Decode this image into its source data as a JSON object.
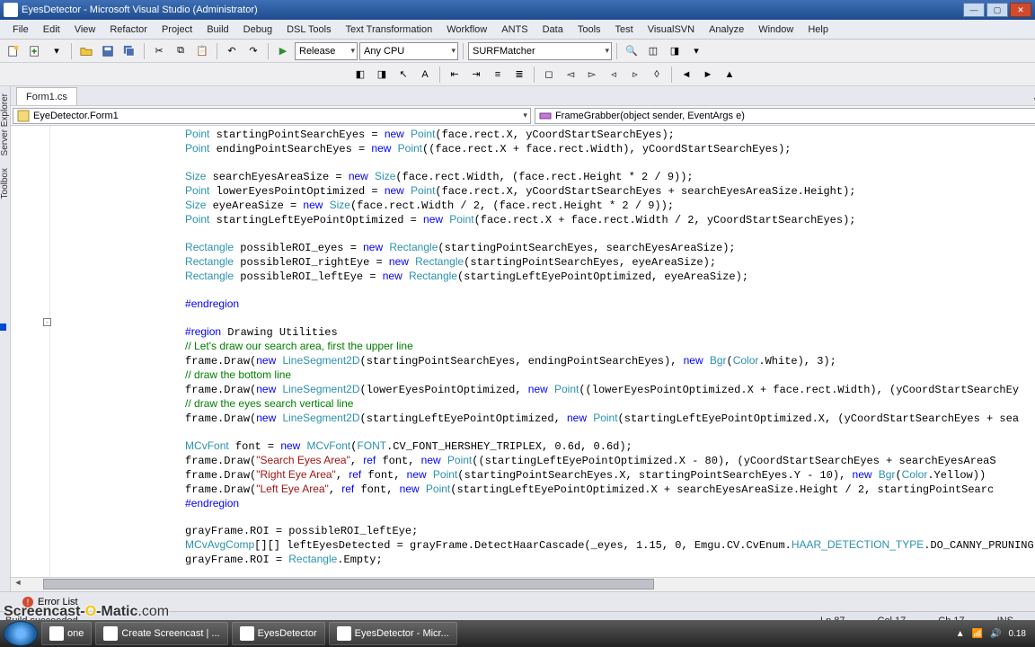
{
  "window": {
    "title": "EyesDetector - Microsoft Visual Studio (Administrator)"
  },
  "menu": {
    "items": [
      "File",
      "Edit",
      "View",
      "Refactor",
      "Project",
      "Build",
      "Debug",
      "DSL Tools",
      "Text Transformation",
      "Workflow",
      "ANTS",
      "Data",
      "Tools",
      "Test",
      "VisualSVN",
      "Analyze",
      "Window",
      "Help"
    ]
  },
  "toolbar": {
    "config": "Release",
    "platform": "Any CPU",
    "startup": "SURFMatcher"
  },
  "doc": {
    "tab": "Form1.cs"
  },
  "nav": {
    "type": "EyeDetector.Form1",
    "member": "FrameGrabber(object sender, EventArgs e)"
  },
  "bottom": {
    "errorlist": "Error List"
  },
  "status": {
    "build": "Build succeeded",
    "ln": "Ln 87",
    "col": "Col 17",
    "ch": "Ch 17",
    "ins": "INS"
  },
  "leftpanels": [
    "Server Explorer",
    "Toolbox"
  ],
  "taskbar": {
    "items": [
      "one",
      "Create Screencast | ...",
      "EyesDetector",
      "EyesDetector - Micr..."
    ],
    "time": "0.18"
  },
  "watermark": {
    "a": "Screencast-",
    "b": "O",
    "c": "-Matic",
    "d": ".com"
  },
  "code": {
    "lines": [
      {
        "indent": 20,
        "t": [
          [
            "typ",
            "Point"
          ],
          [
            "",
            " startingPointSearchEyes = "
          ],
          [
            "kw",
            "new"
          ],
          [
            "",
            " "
          ],
          [
            "typ",
            "Point"
          ],
          [
            "",
            "(face.rect.X, yCoordStartSearchEyes);"
          ]
        ]
      },
      {
        "indent": 20,
        "t": [
          [
            "typ",
            "Point"
          ],
          [
            "",
            " endingPointSearchEyes = "
          ],
          [
            "kw",
            "new"
          ],
          [
            "",
            " "
          ],
          [
            "typ",
            "Point"
          ],
          [
            "",
            "((face.rect.X + face.rect.Width), yCoordStartSearchEyes);"
          ]
        ]
      },
      {
        "blank": true
      },
      {
        "indent": 20,
        "t": [
          [
            "typ",
            "Size"
          ],
          [
            "",
            " searchEyesAreaSize = "
          ],
          [
            "kw",
            "new"
          ],
          [
            "",
            " "
          ],
          [
            "typ",
            "Size"
          ],
          [
            "",
            "(face.rect.Width, (face.rect.Height * 2 / 9));"
          ]
        ]
      },
      {
        "indent": 20,
        "t": [
          [
            "typ",
            "Point"
          ],
          [
            "",
            " lowerEyesPointOptimized = "
          ],
          [
            "kw",
            "new"
          ],
          [
            "",
            " "
          ],
          [
            "typ",
            "Point"
          ],
          [
            "",
            "(face.rect.X, yCoordStartSearchEyes + searchEyesAreaSize.Height);"
          ]
        ]
      },
      {
        "indent": 20,
        "t": [
          [
            "typ",
            "Size"
          ],
          [
            "",
            " eyeAreaSize = "
          ],
          [
            "kw",
            "new"
          ],
          [
            "",
            " "
          ],
          [
            "typ",
            "Size"
          ],
          [
            "",
            "(face.rect.Width / 2, (face.rect.Height * 2 / 9));"
          ]
        ]
      },
      {
        "indent": 20,
        "t": [
          [
            "typ",
            "Point"
          ],
          [
            "",
            " startingLeftEyePointOptimized = "
          ],
          [
            "kw",
            "new"
          ],
          [
            "",
            " "
          ],
          [
            "typ",
            "Point"
          ],
          [
            "",
            "(face.rect.X + face.rect.Width / 2, yCoordStartSearchEyes);"
          ]
        ]
      },
      {
        "blank": true
      },
      {
        "indent": 20,
        "t": [
          [
            "typ",
            "Rectangle"
          ],
          [
            "",
            " possibleROI_eyes = "
          ],
          [
            "kw",
            "new"
          ],
          [
            "",
            " "
          ],
          [
            "typ",
            "Rectangle"
          ],
          [
            "",
            "(startingPointSearchEyes, searchEyesAreaSize);"
          ]
        ]
      },
      {
        "indent": 20,
        "t": [
          [
            "typ",
            "Rectangle"
          ],
          [
            "",
            " possibleROI_rightEye = "
          ],
          [
            "kw",
            "new"
          ],
          [
            "",
            " "
          ],
          [
            "typ",
            "Rectangle"
          ],
          [
            "",
            "(startingPointSearchEyes, eyeAreaSize);"
          ]
        ]
      },
      {
        "indent": 20,
        "t": [
          [
            "typ",
            "Rectangle"
          ],
          [
            "",
            " possibleROI_leftEye = "
          ],
          [
            "kw",
            "new"
          ],
          [
            "",
            " "
          ],
          [
            "typ",
            "Rectangle"
          ],
          [
            "",
            "(startingLeftEyePointOptimized, eyeAreaSize);"
          ]
        ]
      },
      {
        "blank": true
      },
      {
        "indent": 20,
        "t": [
          [
            "pp",
            "#endregion"
          ]
        ]
      },
      {
        "blank": true
      },
      {
        "indent": 20,
        "t": [
          [
            "pp",
            "#region"
          ],
          [
            "",
            " Drawing Utilities"
          ]
        ]
      },
      {
        "indent": 20,
        "t": [
          [
            "cmt",
            "// Let's draw our search area, first the upper line"
          ]
        ]
      },
      {
        "indent": 20,
        "t": [
          [
            "",
            "frame.Draw("
          ],
          [
            "kw",
            "new"
          ],
          [
            "",
            " "
          ],
          [
            "typ",
            "LineSegment2D"
          ],
          [
            "",
            "(startingPointSearchEyes, endingPointSearchEyes), "
          ],
          [
            "kw",
            "new"
          ],
          [
            "",
            " "
          ],
          [
            "typ",
            "Bgr"
          ],
          [
            "",
            "("
          ],
          [
            "typ",
            "Color"
          ],
          [
            "",
            ".White), 3);"
          ]
        ]
      },
      {
        "indent": 20,
        "t": [
          [
            "cmt",
            "// draw the bottom line"
          ]
        ]
      },
      {
        "indent": 20,
        "t": [
          [
            "",
            "frame.Draw("
          ],
          [
            "kw",
            "new"
          ],
          [
            "",
            " "
          ],
          [
            "typ",
            "LineSegment2D"
          ],
          [
            "",
            "(lowerEyesPointOptimized, "
          ],
          [
            "kw",
            "new"
          ],
          [
            "",
            " "
          ],
          [
            "typ",
            "Point"
          ],
          [
            "",
            "((lowerEyesPointOptimized.X + face.rect.Width), (yCoordStartSearchEy"
          ]
        ]
      },
      {
        "indent": 20,
        "t": [
          [
            "cmt",
            "// draw the eyes search vertical line"
          ]
        ]
      },
      {
        "indent": 20,
        "t": [
          [
            "",
            "frame.Draw("
          ],
          [
            "kw",
            "new"
          ],
          [
            "",
            " "
          ],
          [
            "typ",
            "LineSegment2D"
          ],
          [
            "",
            "(startingLeftEyePointOptimized, "
          ],
          [
            "kw",
            "new"
          ],
          [
            "",
            " "
          ],
          [
            "typ",
            "Point"
          ],
          [
            "",
            "(startingLeftEyePointOptimized.X, (yCoordStartSearchEyes + sea"
          ]
        ]
      },
      {
        "blank": true
      },
      {
        "indent": 20,
        "t": [
          [
            "typ",
            "MCvFont"
          ],
          [
            "",
            " font = "
          ],
          [
            "kw",
            "new"
          ],
          [
            "",
            " "
          ],
          [
            "typ",
            "MCvFont"
          ],
          [
            "",
            "("
          ],
          [
            "typ",
            "FONT"
          ],
          [
            "",
            ".CV_FONT_HERSHEY_TRIPLEX, 0.6d, 0.6d);"
          ]
        ]
      },
      {
        "indent": 20,
        "t": [
          [
            "",
            "frame.Draw("
          ],
          [
            "str",
            "\"Search Eyes Area\""
          ],
          [
            "",
            ", "
          ],
          [
            "kw",
            "ref"
          ],
          [
            "",
            " font, "
          ],
          [
            "kw",
            "new"
          ],
          [
            "",
            " "
          ],
          [
            "typ",
            "Point"
          ],
          [
            "",
            "((startingLeftEyePointOptimized.X - 80), (yCoordStartSearchEyes + searchEyesAreaS"
          ]
        ]
      },
      {
        "indent": 20,
        "t": [
          [
            "",
            "frame.Draw("
          ],
          [
            "str",
            "\"Right Eye Area\""
          ],
          [
            "",
            ", "
          ],
          [
            "kw",
            "ref"
          ],
          [
            "",
            " font, "
          ],
          [
            "kw",
            "new"
          ],
          [
            "",
            " "
          ],
          [
            "typ",
            "Point"
          ],
          [
            "",
            "(startingPointSearchEyes.X, startingPointSearchEyes.Y - 10), "
          ],
          [
            "kw",
            "new"
          ],
          [
            "",
            " "
          ],
          [
            "typ",
            "Bgr"
          ],
          [
            "",
            "("
          ],
          [
            "typ",
            "Color"
          ],
          [
            "",
            ".Yellow))"
          ]
        ]
      },
      {
        "indent": 20,
        "t": [
          [
            "",
            "frame.Draw("
          ],
          [
            "str",
            "\"Left Eye Area\""
          ],
          [
            "",
            ", "
          ],
          [
            "kw",
            "ref"
          ],
          [
            "",
            " font, "
          ],
          [
            "kw",
            "new"
          ],
          [
            "",
            " "
          ],
          [
            "typ",
            "Point"
          ],
          [
            "",
            "(startingLeftEyePointOptimized.X + searchEyesAreaSize.Height / 2, startingPointSearc"
          ]
        ]
      },
      {
        "indent": 20,
        "t": [
          [
            "pp",
            "#endregion"
          ]
        ]
      },
      {
        "blank": true
      },
      {
        "indent": 20,
        "t": [
          [
            "",
            "grayFrame.ROI = possibleROI_leftEye;"
          ]
        ]
      },
      {
        "indent": 20,
        "t": [
          [
            "typ",
            "MCvAvgComp"
          ],
          [
            "",
            "[][] leftEyesDetected = grayFrame.DetectHaarCascade(_eyes, 1.15, 0, Emgu.CV.CvEnum."
          ],
          [
            "enm",
            "HAAR_DETECTION_TYPE"
          ],
          [
            "",
            ".DO_CANNY_PRUNING,"
          ]
        ]
      },
      {
        "indent": 20,
        "t": [
          [
            "",
            "grayFrame.ROI = "
          ],
          [
            "typ",
            "Rectangle"
          ],
          [
            "",
            ".Empty;"
          ]
        ]
      }
    ]
  }
}
